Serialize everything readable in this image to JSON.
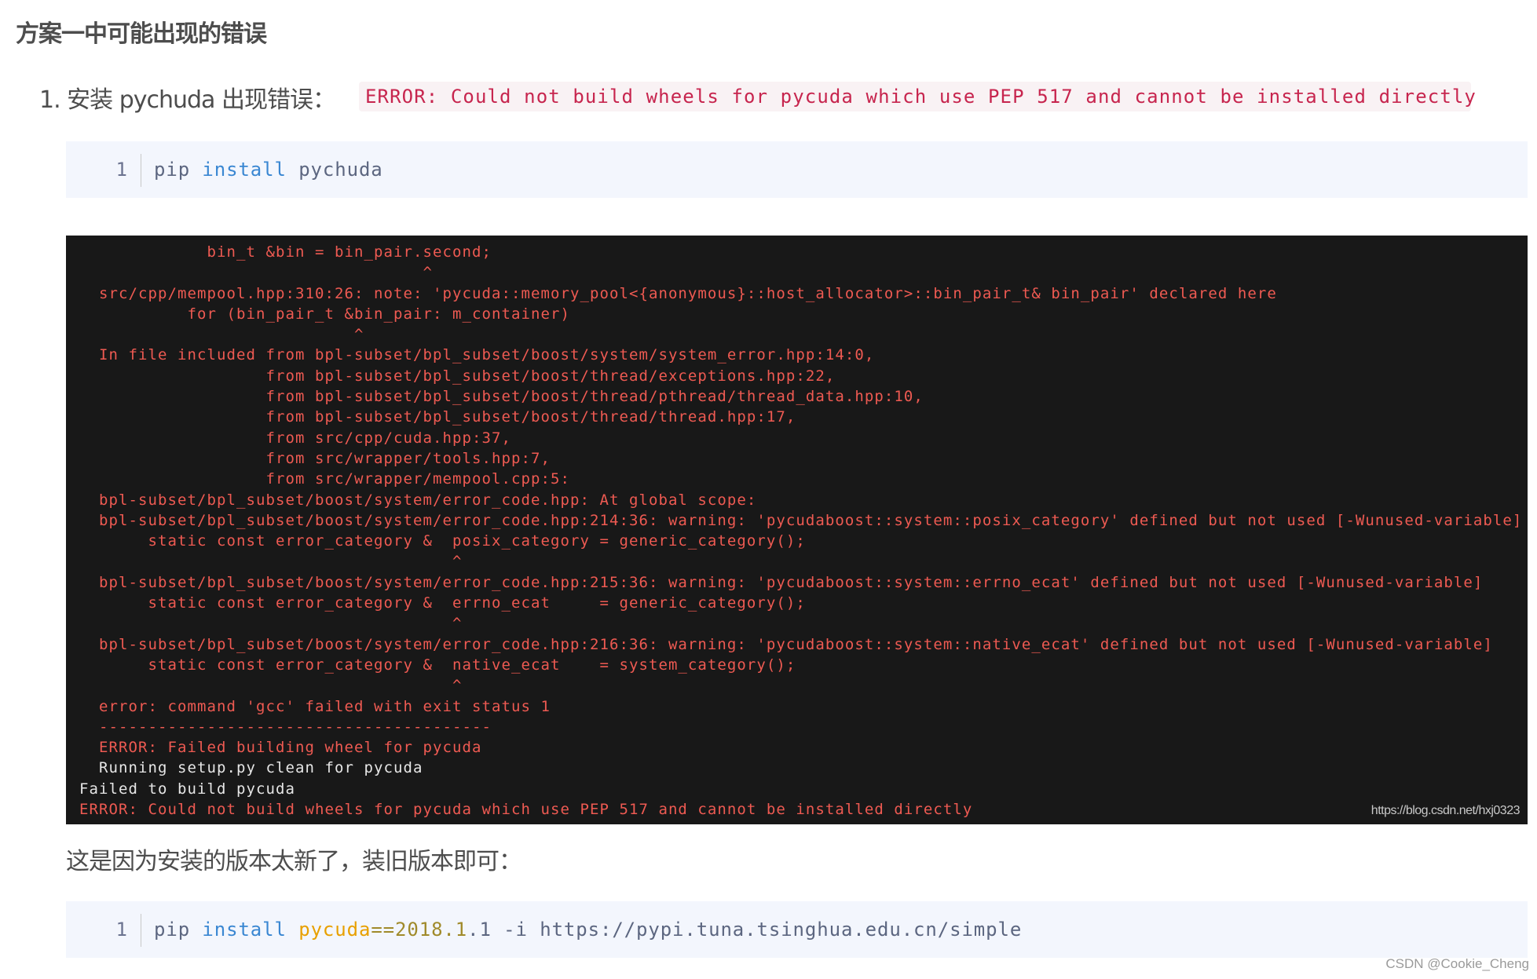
{
  "heading": "方案一中可能出现的错误",
  "list_item": {
    "label": "1. 安装 pychuda 出现错误：",
    "inline_code": "ERROR: Could not build wheels for pycuda which use PEP 517 and cannot be installed directly"
  },
  "code_block_1": {
    "line_number": "1",
    "tokens": [
      {
        "text": "pip ",
        "kind": "plain"
      },
      {
        "text": "install",
        "kind": "kw"
      },
      {
        "text": " pychuda",
        "kind": "plain"
      }
    ]
  },
  "terminal": {
    "colors": {
      "error": "#ee5a52",
      "plain": "#e6e6e6",
      "background": "#181818"
    },
    "lines": [
      {
        "text": "             bin_t &bin = bin_pair.second;",
        "kind": "error"
      },
      {
        "text": "                                   ^",
        "kind": "error"
      },
      {
        "text": "  src/cpp/mempool.hpp:310:26: note: 'pycuda::memory_pool<{anonymous}::host_allocator>::bin_pair_t& bin_pair' declared here",
        "kind": "error"
      },
      {
        "text": "           for (bin_pair_t &bin_pair: m_container)",
        "kind": "error"
      },
      {
        "text": "                            ^",
        "kind": "error"
      },
      {
        "text": "  In file included from bpl-subset/bpl_subset/boost/system/system_error.hpp:14:0,",
        "kind": "error"
      },
      {
        "text": "                   from bpl-subset/bpl_subset/boost/thread/exceptions.hpp:22,",
        "kind": "error"
      },
      {
        "text": "                   from bpl-subset/bpl_subset/boost/thread/pthread/thread_data.hpp:10,",
        "kind": "error"
      },
      {
        "text": "                   from bpl-subset/bpl_subset/boost/thread/thread.hpp:17,",
        "kind": "error"
      },
      {
        "text": "                   from src/cpp/cuda.hpp:37,",
        "kind": "error"
      },
      {
        "text": "                   from src/wrapper/tools.hpp:7,",
        "kind": "error"
      },
      {
        "text": "                   from src/wrapper/mempool.cpp:5:",
        "kind": "error"
      },
      {
        "text": "  bpl-subset/bpl_subset/boost/system/error_code.hpp: At global scope:",
        "kind": "error"
      },
      {
        "text": "  bpl-subset/bpl_subset/boost/system/error_code.hpp:214:36: warning: 'pycudaboost::system::posix_category' defined but not used [-Wunused-variable]",
        "kind": "error"
      },
      {
        "text": "       static const error_category &  posix_category = generic_category();",
        "kind": "error"
      },
      {
        "text": "                                      ^",
        "kind": "error"
      },
      {
        "text": "  bpl-subset/bpl_subset/boost/system/error_code.hpp:215:36: warning: 'pycudaboost::system::errno_ecat' defined but not used [-Wunused-variable]",
        "kind": "error"
      },
      {
        "text": "       static const error_category &  errno_ecat     = generic_category();",
        "kind": "error"
      },
      {
        "text": "                                      ^",
        "kind": "error"
      },
      {
        "text": "  bpl-subset/bpl_subset/boost/system/error_code.hpp:216:36: warning: 'pycudaboost::system::native_ecat' defined but not used [-Wunused-variable]",
        "kind": "error"
      },
      {
        "text": "       static const error_category &  native_ecat    = system_category();",
        "kind": "error"
      },
      {
        "text": "                                      ^",
        "kind": "error"
      },
      {
        "text": "  error: command 'gcc' failed with exit status 1",
        "kind": "error"
      },
      {
        "text": "  ----------------------------------------",
        "kind": "error"
      },
      {
        "text": "  ERROR: Failed building wheel for pycuda",
        "kind": "error"
      },
      {
        "text": "  Running setup.py clean for pycuda",
        "kind": "plain"
      },
      {
        "text": "Failed to build pycuda",
        "kind": "plain"
      },
      {
        "text": "ERROR: Could not build wheels for pycuda which use PEP 517 and cannot be installed directly",
        "kind": "error"
      }
    ],
    "watermark": "https://blog.csdn.net/hxj0323"
  },
  "paragraph": "这是因为安装的版本太新了，装旧版本即可：",
  "code_block_2": {
    "line_number": "1",
    "tokens": [
      {
        "text": "pip ",
        "kind": "plain"
      },
      {
        "text": "install",
        "kind": "kw"
      },
      {
        "text": " ",
        "kind": "plain"
      },
      {
        "text": "pycuda",
        "kind": "pkg"
      },
      {
        "text": "==2018.1",
        "kind": "ver"
      },
      {
        "text": ".1 -i https://pypi.tuna.tsinghua.edu.cn/simple",
        "kind": "plain"
      }
    ]
  },
  "page_watermark": "CSDN @Cookie_Cheng"
}
